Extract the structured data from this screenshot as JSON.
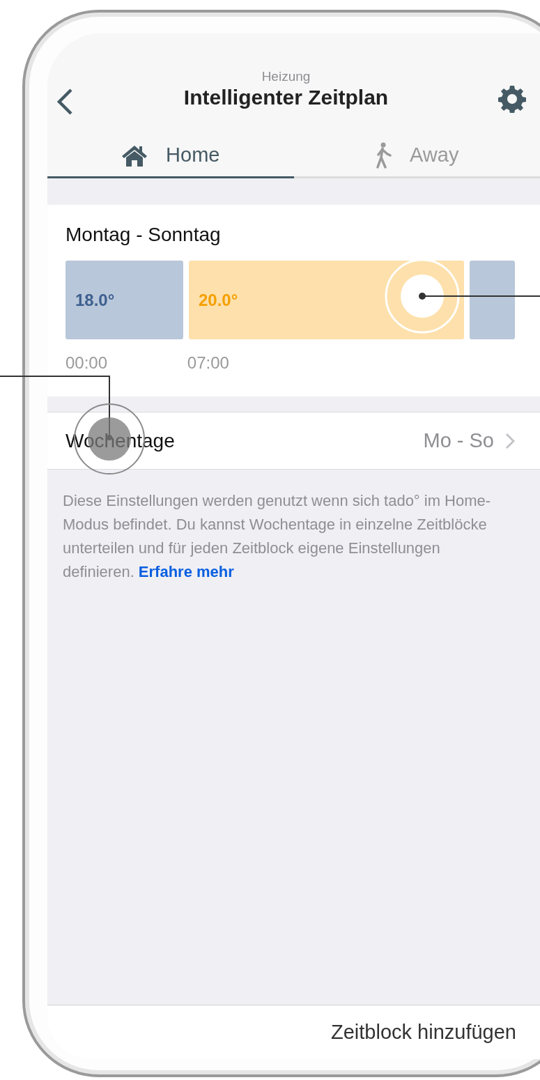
{
  "header": {
    "subtitle": "Heizung",
    "title": "Intelligenter Zeitplan"
  },
  "tabs": [
    {
      "label": "Home",
      "kind": "home",
      "selected": true
    },
    {
      "label": "Away",
      "kind": "away",
      "selected": false
    }
  ],
  "schedule": {
    "title": "Montag - Sonntag",
    "blocks": [
      {
        "kind": "cool",
        "temperature": "18.0°",
        "time": "00:00"
      },
      {
        "kind": "warm",
        "temperature": "20.0°",
        "time": "07:00"
      },
      {
        "kind": "cool"
      }
    ]
  },
  "weekdays_row": {
    "label": "Wochentage",
    "value": "Mo - So"
  },
  "description": {
    "text": "Diese Einstellungen werden genutzt wenn sich tado° im Home-Modus befindet. Du kannst Wochentage in einzelne Zeitblöcke unterteilen und für jeden Zeitblock eigene Einstellungen definieren.",
    "link": "Erfahre mehr"
  },
  "footer": {
    "action": "Zeitblock hinzufügen"
  }
}
